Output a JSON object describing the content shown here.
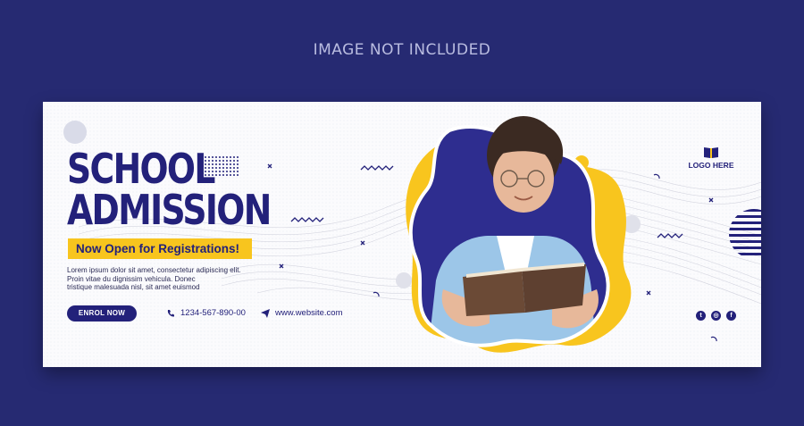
{
  "watermark": "IMAGE NOT INCLUDED",
  "headline": {
    "line1": "SCHOOL",
    "line2": "ADMISSION"
  },
  "subheadline": "Now Open for Registrations!",
  "body_lines": [
    "Lorem ipsum dolor sit amet, consectetur adipiscing elit.",
    "Proin vitae du dignissim vehicula. Donec",
    "tristique malesuada nisl, sit amet euismod"
  ],
  "cta_label": "ENROL NOW",
  "phone": "1234-567-890-00",
  "website": "www.website.com",
  "logo_text": "LOGO HERE",
  "colors": {
    "navy": "#23217a",
    "yellow": "#f8c51e",
    "background": "#262a72",
    "blob": "#2e2d8f"
  },
  "icons": [
    "phone-icon",
    "send-icon",
    "book-logo-icon",
    "twitter-icon",
    "instagram-icon",
    "facebook-icon"
  ]
}
